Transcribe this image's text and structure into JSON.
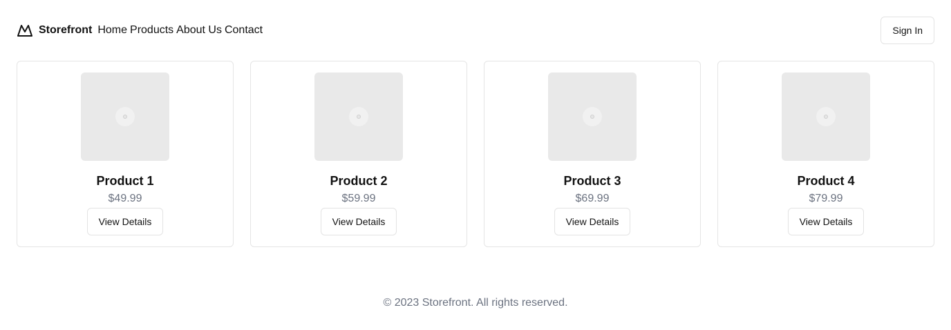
{
  "header": {
    "brand": "Storefront",
    "logo_icon": "mountain-icon",
    "nav": [
      "Home",
      "Products",
      "About Us",
      "Contact"
    ],
    "signin_label": "Sign In"
  },
  "products": [
    {
      "name": "Product 1",
      "price": "$49.99",
      "button": "View Details",
      "image_icon": "image-placeholder-icon"
    },
    {
      "name": "Product 2",
      "price": "$59.99",
      "button": "View Details",
      "image_icon": "image-placeholder-icon"
    },
    {
      "name": "Product 3",
      "price": "$69.99",
      "button": "View Details",
      "image_icon": "image-placeholder-icon"
    },
    {
      "name": "Product 4",
      "price": "$79.99",
      "button": "View Details",
      "image_icon": "image-placeholder-icon"
    }
  ],
  "footer": {
    "text": "© 2023 Storefront. All rights reserved."
  }
}
